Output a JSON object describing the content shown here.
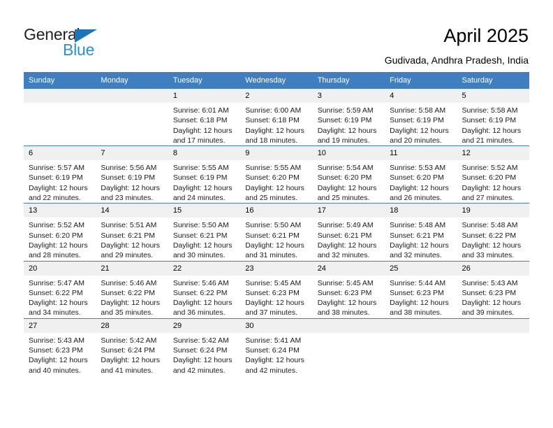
{
  "brand": {
    "name_part1": "General",
    "name_part2": "Blue",
    "triangle_icon": "triangle-icon",
    "accent_color": "#1b75bb",
    "accent_color_light": "#2b8fd4"
  },
  "header": {
    "title": "April 2025",
    "location": "Gudivada, Andhra Pradesh, India"
  },
  "theme": {
    "header_row_bg": "#3f7fc1",
    "day_number_bg": "#f0f0f0",
    "grid_line": "#3f7fc1",
    "text": "#000000"
  },
  "calendar": {
    "weekday_headers": [
      "Sunday",
      "Monday",
      "Tuesday",
      "Wednesday",
      "Thursday",
      "Friday",
      "Saturday"
    ],
    "labels": {
      "sunrise_prefix": "Sunrise:",
      "sunset_prefix": "Sunset:",
      "daylight_prefix": "Daylight:"
    },
    "weeks": [
      [
        {
          "day": "",
          "sunrise": "",
          "sunset": "",
          "daylight_line1": "",
          "daylight_line2": ""
        },
        {
          "day": "",
          "sunrise": "",
          "sunset": "",
          "daylight_line1": "",
          "daylight_line2": ""
        },
        {
          "day": "1",
          "sunrise": "Sunrise: 6:01 AM",
          "sunset": "Sunset: 6:18 PM",
          "daylight_line1": "Daylight: 12 hours",
          "daylight_line2": "and 17 minutes."
        },
        {
          "day": "2",
          "sunrise": "Sunrise: 6:00 AM",
          "sunset": "Sunset: 6:18 PM",
          "daylight_line1": "Daylight: 12 hours",
          "daylight_line2": "and 18 minutes."
        },
        {
          "day": "3",
          "sunrise": "Sunrise: 5:59 AM",
          "sunset": "Sunset: 6:19 PM",
          "daylight_line1": "Daylight: 12 hours",
          "daylight_line2": "and 19 minutes."
        },
        {
          "day": "4",
          "sunrise": "Sunrise: 5:58 AM",
          "sunset": "Sunset: 6:19 PM",
          "daylight_line1": "Daylight: 12 hours",
          "daylight_line2": "and 20 minutes."
        },
        {
          "day": "5",
          "sunrise": "Sunrise: 5:58 AM",
          "sunset": "Sunset: 6:19 PM",
          "daylight_line1": "Daylight: 12 hours",
          "daylight_line2": "and 21 minutes."
        }
      ],
      [
        {
          "day": "6",
          "sunrise": "Sunrise: 5:57 AM",
          "sunset": "Sunset: 6:19 PM",
          "daylight_line1": "Daylight: 12 hours",
          "daylight_line2": "and 22 minutes."
        },
        {
          "day": "7",
          "sunrise": "Sunrise: 5:56 AM",
          "sunset": "Sunset: 6:19 PM",
          "daylight_line1": "Daylight: 12 hours",
          "daylight_line2": "and 23 minutes."
        },
        {
          "day": "8",
          "sunrise": "Sunrise: 5:55 AM",
          "sunset": "Sunset: 6:19 PM",
          "daylight_line1": "Daylight: 12 hours",
          "daylight_line2": "and 24 minutes."
        },
        {
          "day": "9",
          "sunrise": "Sunrise: 5:55 AM",
          "sunset": "Sunset: 6:20 PM",
          "daylight_line1": "Daylight: 12 hours",
          "daylight_line2": "and 25 minutes."
        },
        {
          "day": "10",
          "sunrise": "Sunrise: 5:54 AM",
          "sunset": "Sunset: 6:20 PM",
          "daylight_line1": "Daylight: 12 hours",
          "daylight_line2": "and 25 minutes."
        },
        {
          "day": "11",
          "sunrise": "Sunrise: 5:53 AM",
          "sunset": "Sunset: 6:20 PM",
          "daylight_line1": "Daylight: 12 hours",
          "daylight_line2": "and 26 minutes."
        },
        {
          "day": "12",
          "sunrise": "Sunrise: 5:52 AM",
          "sunset": "Sunset: 6:20 PM",
          "daylight_line1": "Daylight: 12 hours",
          "daylight_line2": "and 27 minutes."
        }
      ],
      [
        {
          "day": "13",
          "sunrise": "Sunrise: 5:52 AM",
          "sunset": "Sunset: 6:20 PM",
          "daylight_line1": "Daylight: 12 hours",
          "daylight_line2": "and 28 minutes."
        },
        {
          "day": "14",
          "sunrise": "Sunrise: 5:51 AM",
          "sunset": "Sunset: 6:21 PM",
          "daylight_line1": "Daylight: 12 hours",
          "daylight_line2": "and 29 minutes."
        },
        {
          "day": "15",
          "sunrise": "Sunrise: 5:50 AM",
          "sunset": "Sunset: 6:21 PM",
          "daylight_line1": "Daylight: 12 hours",
          "daylight_line2": "and 30 minutes."
        },
        {
          "day": "16",
          "sunrise": "Sunrise: 5:50 AM",
          "sunset": "Sunset: 6:21 PM",
          "daylight_line1": "Daylight: 12 hours",
          "daylight_line2": "and 31 minutes."
        },
        {
          "day": "17",
          "sunrise": "Sunrise: 5:49 AM",
          "sunset": "Sunset: 6:21 PM",
          "daylight_line1": "Daylight: 12 hours",
          "daylight_line2": "and 32 minutes."
        },
        {
          "day": "18",
          "sunrise": "Sunrise: 5:48 AM",
          "sunset": "Sunset: 6:21 PM",
          "daylight_line1": "Daylight: 12 hours",
          "daylight_line2": "and 32 minutes."
        },
        {
          "day": "19",
          "sunrise": "Sunrise: 5:48 AM",
          "sunset": "Sunset: 6:22 PM",
          "daylight_line1": "Daylight: 12 hours",
          "daylight_line2": "and 33 minutes."
        }
      ],
      [
        {
          "day": "20",
          "sunrise": "Sunrise: 5:47 AM",
          "sunset": "Sunset: 6:22 PM",
          "daylight_line1": "Daylight: 12 hours",
          "daylight_line2": "and 34 minutes."
        },
        {
          "day": "21",
          "sunrise": "Sunrise: 5:46 AM",
          "sunset": "Sunset: 6:22 PM",
          "daylight_line1": "Daylight: 12 hours",
          "daylight_line2": "and 35 minutes."
        },
        {
          "day": "22",
          "sunrise": "Sunrise: 5:46 AM",
          "sunset": "Sunset: 6:22 PM",
          "daylight_line1": "Daylight: 12 hours",
          "daylight_line2": "and 36 minutes."
        },
        {
          "day": "23",
          "sunrise": "Sunrise: 5:45 AM",
          "sunset": "Sunset: 6:23 PM",
          "daylight_line1": "Daylight: 12 hours",
          "daylight_line2": "and 37 minutes."
        },
        {
          "day": "24",
          "sunrise": "Sunrise: 5:45 AM",
          "sunset": "Sunset: 6:23 PM",
          "daylight_line1": "Daylight: 12 hours",
          "daylight_line2": "and 38 minutes."
        },
        {
          "day": "25",
          "sunrise": "Sunrise: 5:44 AM",
          "sunset": "Sunset: 6:23 PM",
          "daylight_line1": "Daylight: 12 hours",
          "daylight_line2": "and 38 minutes."
        },
        {
          "day": "26",
          "sunrise": "Sunrise: 5:43 AM",
          "sunset": "Sunset: 6:23 PM",
          "daylight_line1": "Daylight: 12 hours",
          "daylight_line2": "and 39 minutes."
        }
      ],
      [
        {
          "day": "27",
          "sunrise": "Sunrise: 5:43 AM",
          "sunset": "Sunset: 6:23 PM",
          "daylight_line1": "Daylight: 12 hours",
          "daylight_line2": "and 40 minutes."
        },
        {
          "day": "28",
          "sunrise": "Sunrise: 5:42 AM",
          "sunset": "Sunset: 6:24 PM",
          "daylight_line1": "Daylight: 12 hours",
          "daylight_line2": "and 41 minutes."
        },
        {
          "day": "29",
          "sunrise": "Sunrise: 5:42 AM",
          "sunset": "Sunset: 6:24 PM",
          "daylight_line1": "Daylight: 12 hours",
          "daylight_line2": "and 42 minutes."
        },
        {
          "day": "30",
          "sunrise": "Sunrise: 5:41 AM",
          "sunset": "Sunset: 6:24 PM",
          "daylight_line1": "Daylight: 12 hours",
          "daylight_line2": "and 42 minutes."
        },
        {
          "day": "",
          "sunrise": "",
          "sunset": "",
          "daylight_line1": "",
          "daylight_line2": ""
        },
        {
          "day": "",
          "sunrise": "",
          "sunset": "",
          "daylight_line1": "",
          "daylight_line2": ""
        },
        {
          "day": "",
          "sunrise": "",
          "sunset": "",
          "daylight_line1": "",
          "daylight_line2": ""
        }
      ]
    ]
  }
}
